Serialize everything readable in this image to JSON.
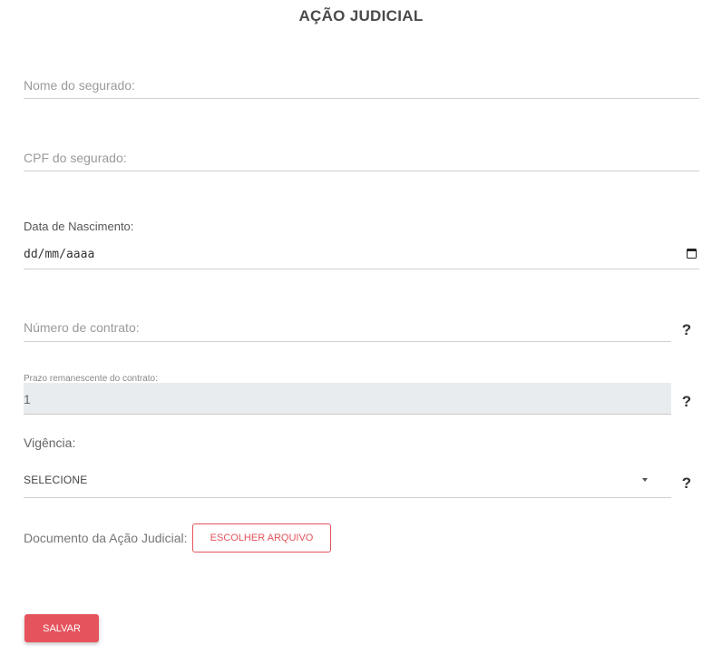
{
  "title": "AÇÃO JUDICIAL",
  "fields": {
    "nome": {
      "placeholder": "Nome do segurado:",
      "value": ""
    },
    "cpf": {
      "placeholder": "CPF do segurado:",
      "value": ""
    },
    "data_nascimento": {
      "label": "Data de Nascimento:",
      "value": "dd/mm/aaaa",
      "icon": "calendar-icon"
    },
    "contrato": {
      "placeholder": "Número de contrato:",
      "value": ""
    },
    "prazo": {
      "label": "Prazo remanescente do contrato:",
      "value": "1"
    },
    "vigencia": {
      "label": "Vigência:",
      "selected": "SELECIONE"
    },
    "documento": {
      "label": "Documento da Ação Judicial:",
      "button_label": "ESCOLHER ARQUIVO"
    }
  },
  "help": {
    "symbol": "?",
    "icon": "question-mark-icon"
  },
  "actions": {
    "save_label": "SALVAR"
  },
  "colors": {
    "accent": "#e5535c",
    "readonly_bg": "#e9ecef",
    "title": "#4a4a4a"
  }
}
